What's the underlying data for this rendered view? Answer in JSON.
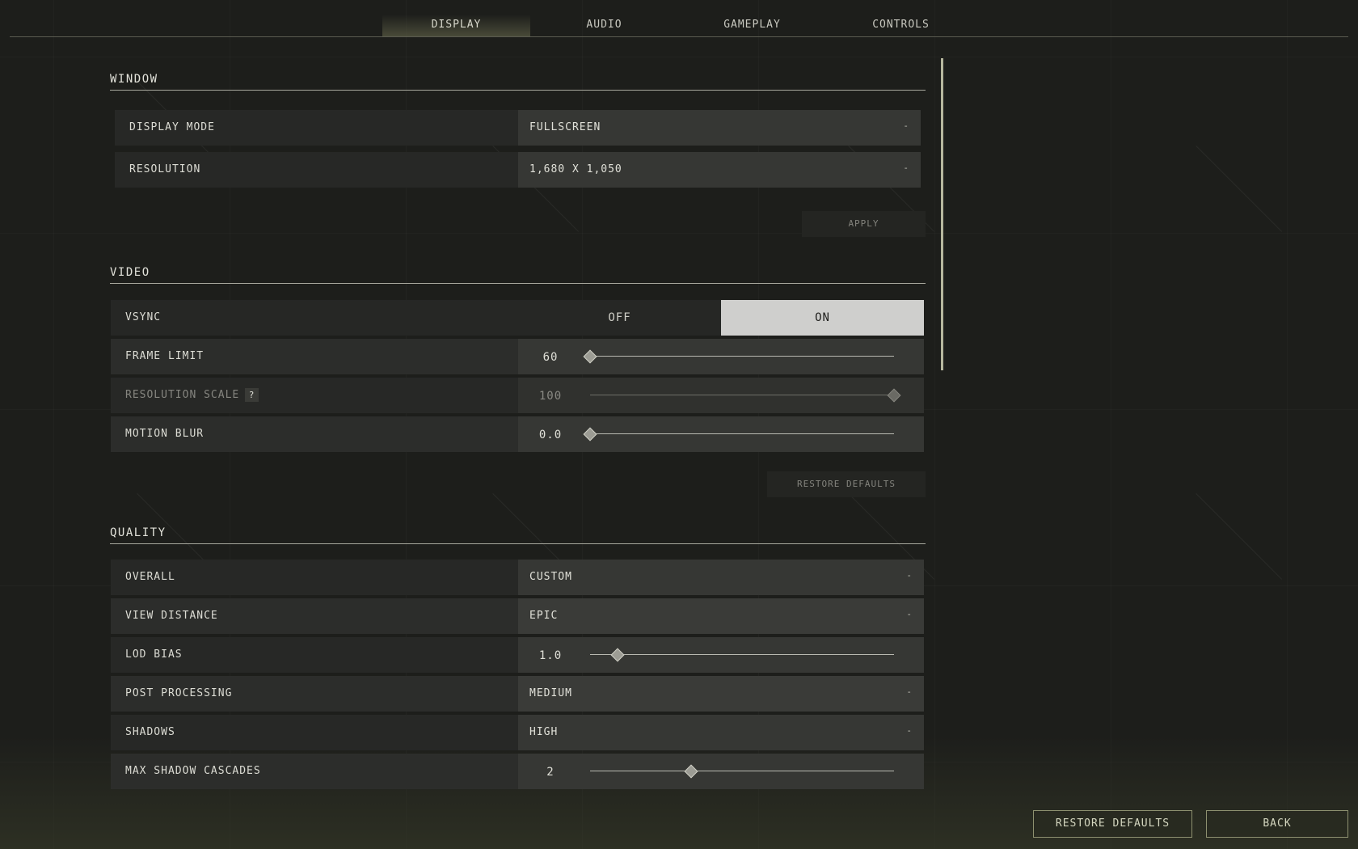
{
  "tabs": [
    {
      "label": "DISPLAY",
      "active": true
    },
    {
      "label": "AUDIO",
      "active": false
    },
    {
      "label": "GAMEPLAY",
      "active": false
    },
    {
      "label": "CONTROLS",
      "active": false
    }
  ],
  "window": {
    "title": "WINDOW",
    "display_mode": {
      "label": "DISPLAY MODE",
      "value": "FULLSCREEN",
      "caret": "-"
    },
    "resolution": {
      "label": "RESOLUTION",
      "value": "1,680 X 1,050",
      "caret": "-"
    },
    "apply_label": "APPLY"
  },
  "video": {
    "title": "VIDEO",
    "vsync": {
      "label": "VSYNC",
      "off": "OFF",
      "on": "ON",
      "selected": "ON"
    },
    "frame_limit": {
      "label": "FRAME LIMIT",
      "value": "60",
      "fraction": 0.0
    },
    "resolution_scale": {
      "label": "RESOLUTION SCALE",
      "help": "?",
      "value": "100",
      "fraction": 1.0,
      "disabled": true
    },
    "motion_blur": {
      "label": "MOTION BLUR",
      "value": "0.0",
      "fraction": 0.0
    },
    "restore_label": "RESTORE DEFAULTS"
  },
  "quality": {
    "title": "QUALITY",
    "overall": {
      "label": "OVERALL",
      "value": "CUSTOM",
      "caret": "-"
    },
    "view_distance": {
      "label": "VIEW DISTANCE",
      "value": "EPIC",
      "caret": "-"
    },
    "lod_bias": {
      "label": "LOD BIAS",
      "value": "1.0",
      "fraction": 0.09
    },
    "post_processing": {
      "label": "POST PROCESSING",
      "value": "MEDIUM",
      "caret": "-"
    },
    "shadows": {
      "label": "SHADOWS",
      "value": "HIGH",
      "caret": "-"
    },
    "max_shadow_cascades": {
      "label": "MAX SHADOW CASCADES",
      "value": "2",
      "fraction": 0.333
    }
  },
  "footer": {
    "restore_label": "RESTORE DEFAULTS",
    "back_label": "BACK"
  },
  "colors": {
    "background": "#1d1e1b",
    "accent": "#8e9170",
    "toggle_on": "#cfcfcd"
  }
}
